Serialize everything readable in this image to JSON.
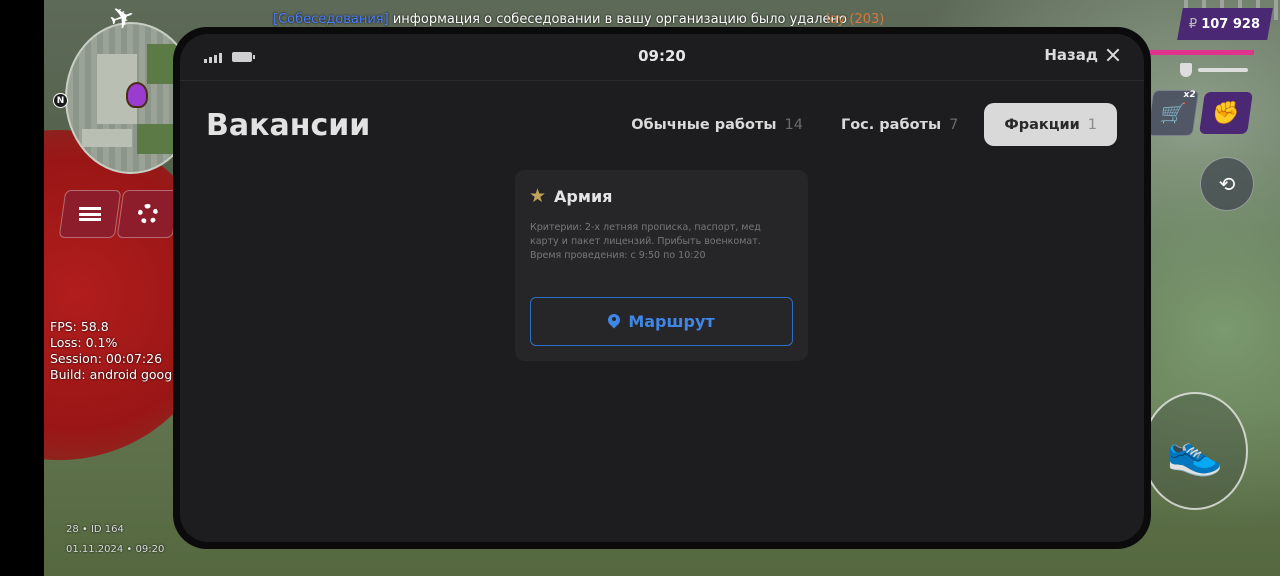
{
  "hud": {
    "chat_tag": "[Собеседования]",
    "chat_message": "информация о собеседовании в вашу организацию было удалено",
    "chat_tail": "loy (203)",
    "money_currency": "₽",
    "money_value": "107 928",
    "cart_multiplier": "x2",
    "debug": {
      "fps": "FPS: 58.8",
      "loss": "Loss: 0.1%",
      "session": "Session: 00:07:26",
      "build": "Build: android goog"
    },
    "footer_id": "28 • ID 164",
    "footer_datetime": "01.11.2024 • 09:20",
    "icons": [
      "plane-icon",
      "north-icon",
      "menu-icon",
      "settings-icon",
      "cart-icon",
      "fist-icon",
      "camera-icon",
      "sneaker-icon"
    ]
  },
  "device": {
    "clock": "09:20",
    "back_label": "Назад",
    "title": "Вакансии",
    "tabs": [
      {
        "label": "Обычные работы",
        "count": "14",
        "active": false
      },
      {
        "label": "Гос. работы",
        "count": "7",
        "active": false
      },
      {
        "label": "Фракции",
        "count": "1",
        "active": true
      }
    ],
    "job": {
      "title": "Армия",
      "description": "Критерии: 2-х летняя прописка, паспорт, мед карту и пакет лицензий. Прибыть военкомат. Время проведения: с 9:50 по 10:20",
      "route_label": "Маршрут"
    }
  },
  "colors": {
    "accent_blue": "#3f86e6",
    "star_gold": "#c3a35a",
    "health_pink": "#e0338d",
    "money_purple": "#4a2874"
  }
}
